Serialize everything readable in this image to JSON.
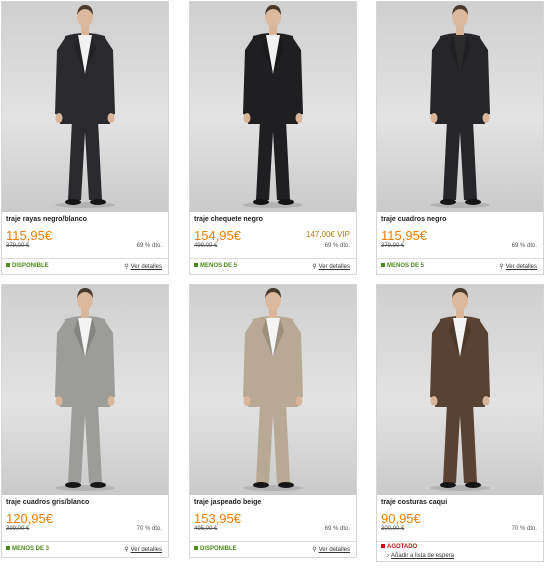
{
  "products": [
    {
      "name": "traje rayas negro/blanco",
      "price": "115,95€",
      "vip": "",
      "original": "379,00 €",
      "discount": "69 % dto.",
      "status": "DISPONIBLE",
      "status_type": "available",
      "detail_label": "Ver detalles",
      "suit_color": "#2a2a2e",
      "shirt_color": "#f2f2f2"
    },
    {
      "name": "traje chequete negro",
      "price": "154,95€",
      "vip": "147,00€ VIP",
      "original": "499,00 €",
      "discount": "69 % dto.",
      "status": "MENOS DE 5",
      "status_type": "available",
      "detail_label": "Ver detalles",
      "suit_color": "#1f1f22",
      "shirt_color": "#f2f2f2"
    },
    {
      "name": "traje cuadros negro",
      "price": "115,95€",
      "vip": "",
      "original": "379,00 €",
      "discount": "69 % dto.",
      "status": "MENOS DE 5",
      "status_type": "available",
      "detail_label": "Ver detalles",
      "suit_color": "#26262a",
      "shirt_color": "#2b2b2b"
    },
    {
      "name": "traje cuadros gris/blanco",
      "price": "120,95€",
      "vip": "",
      "original": "399,00 €",
      "discount": "70 % dto.",
      "status": "MENOS DE 3",
      "status_type": "available",
      "detail_label": "Ver detalles",
      "suit_color": "#9c9c98",
      "shirt_color": "#f4f4f4"
    },
    {
      "name": "traje jaspeado beige",
      "price": "153,95€",
      "vip": "",
      "original": "495,00 €",
      "discount": "69 % dto.",
      "status": "DISPONIBLE",
      "status_type": "available",
      "detail_label": "Ver detalles",
      "suit_color": "#b8a994",
      "shirt_color": "#f4f4f4"
    },
    {
      "name": "traje costuras caqui",
      "price": "90,95€",
      "vip": "",
      "original": "300,00 €",
      "discount": "70 % dto.",
      "status": "AGOTADO",
      "status_type": "sold-out",
      "detail_label": "Añadir a lista de espera",
      "suit_color": "#5a4232",
      "shirt_color": "#f4f4f4"
    }
  ],
  "icons": {
    "detail": "magnifier-icon",
    "status": "square-bullet-icon"
  }
}
